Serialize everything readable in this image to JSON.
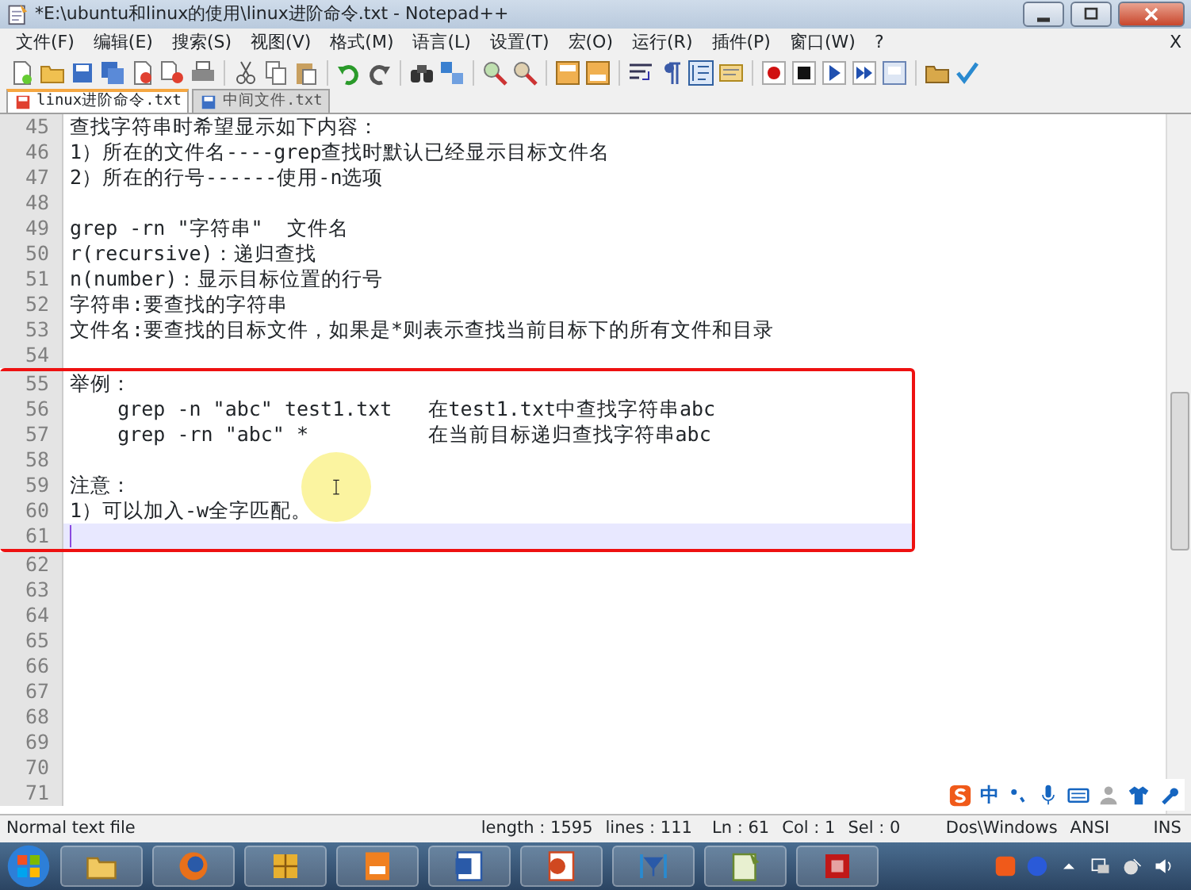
{
  "window": {
    "title": "*E:\\ubuntu和linux的使用\\linux进阶命令.txt - Notepad++"
  },
  "menu": [
    "文件(F)",
    "编辑(E)",
    "搜索(S)",
    "视图(V)",
    "格式(M)",
    "语言(L)",
    "设置(T)",
    "宏(O)",
    "运行(R)",
    "插件(P)",
    "窗口(W)",
    "?"
  ],
  "menu_close": "X",
  "tabs": [
    {
      "label": "linux进阶命令.txt",
      "selected": true,
      "modified": true
    },
    {
      "label": "中间文件.txt",
      "selected": false,
      "modified": false
    }
  ],
  "lines_before": [
    {
      "number": "45",
      "text": "查找字符串时希望显示如下内容：",
      "current": false
    },
    {
      "number": "46",
      "text": "1）所在的文件名----grep查找时默认已经显示目标文件名",
      "current": false
    },
    {
      "number": "47",
      "text": "2）所在的行号------使用-n选项",
      "current": false
    },
    {
      "number": "48",
      "current": false
    },
    {
      "number": "49",
      "text": "grep -rn \"字符串\"  文件名",
      "current": false
    },
    {
      "number": "50",
      "text": "r(recursive)：递归查找",
      "current": false
    },
    {
      "number": "51",
      "text": "n(number)：显示目标位置的行号",
      "current": false
    },
    {
      "number": "52",
      "text": "字符串:要查找的字符串",
      "current": false
    },
    {
      "number": "53",
      "text": "文件名:要查找的目标文件，如果是*则表示查找当前目标下的所有文件和目录",
      "current": false
    },
    {
      "number": "54",
      "current": false
    }
  ],
  "annotated_lines": [
    {
      "number": "55",
      "text": "举例：",
      "current": false
    },
    {
      "number": "56",
      "text": "    grep -n \"abc\" test1.txt   在test1.txt中查找字符串abc",
      "current": false
    },
    {
      "number": "57",
      "text": "    grep -rn \"abc\" *          在当前目标递归查找字符串abc",
      "current": false
    },
    {
      "number": "58",
      "current": false
    },
    {
      "number": "59",
      "text": "注意：",
      "current": false
    },
    {
      "number": "60",
      "text": "1）可以加入-w全字匹配。",
      "current": false
    },
    {
      "number": "61",
      "current": true
    }
  ],
  "lines_after": [
    {
      "number": "62",
      "current": false
    },
    {
      "number": "63",
      "current": false
    },
    {
      "number": "64",
      "current": false
    },
    {
      "number": "65",
      "current": false
    },
    {
      "number": "66",
      "current": false
    },
    {
      "number": "67",
      "current": false
    },
    {
      "number": "68",
      "current": false
    },
    {
      "number": "69",
      "current": false
    },
    {
      "number": "70",
      "current": false
    },
    {
      "number": "71",
      "current": false
    }
  ],
  "ime_bar": {
    "label": "中"
  },
  "status_bar": {
    "file_type": "Normal text file",
    "length": "length : 1595",
    "lines": "lines : 111",
    "ln": "Ln : 61",
    "col": "Col : 1",
    "sel": "Sel : 0",
    "eol": "Dos\\Windows",
    "encoding": "ANSI",
    "mode": "INS"
  }
}
